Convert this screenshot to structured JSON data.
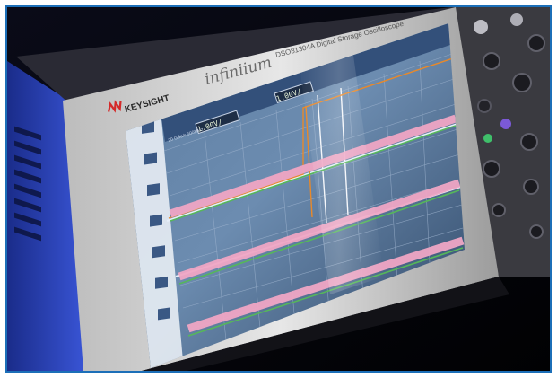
{
  "photo": {
    "brand": "KEYSIGHT",
    "product_line": "infiniium",
    "model": "DSO81304A  Digital Storage Oscilloscope",
    "readout_scale": "1.00V/",
    "readout_second": "1.00V/",
    "readout_timebase": "20 GSa/s    500MHz",
    "colors": {
      "frame_border": "#1c6fb8",
      "trace_pink": "#f0a6c4",
      "trace_green": "#56b75a",
      "trace_orange": "#e8892a",
      "screen_bg": "#4a6a8e"
    }
  }
}
